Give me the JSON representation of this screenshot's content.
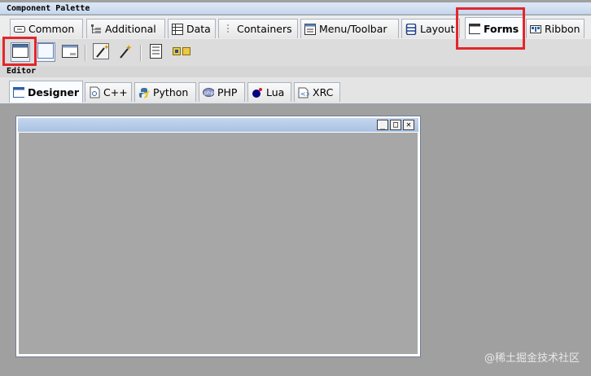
{
  "palette": {
    "header": "Component Palette",
    "tabs": [
      {
        "label": "Common",
        "icon": "button-icon"
      },
      {
        "label": "Additional",
        "icon": "tree-icon"
      },
      {
        "label": "Data",
        "icon": "grid-icon"
      },
      {
        "label": "Containers",
        "icon": "panel-icon"
      },
      {
        "label": "Menu/Toolbar",
        "icon": "menu-icon"
      },
      {
        "label": "Layout",
        "icon": "sizer-icon"
      },
      {
        "label": "Forms",
        "icon": "frame-icon",
        "active": true
      },
      {
        "label": "Ribbon",
        "icon": "ribbon-icon"
      }
    ],
    "toolbar": [
      {
        "icon": "frame-icon"
      },
      {
        "icon": "panel-icon"
      },
      {
        "icon": "dialog-icon"
      },
      {
        "icon": "wizard-icon"
      },
      {
        "icon": "wizard-page-icon"
      },
      {
        "icon": "menubar-icon"
      },
      {
        "icon": "toolbar-icon"
      }
    ]
  },
  "editor": {
    "header": "Editor",
    "tabs": [
      {
        "label": "Designer",
        "icon": "designer-icon",
        "active": true
      },
      {
        "label": "C++",
        "icon": "cpp-file-icon"
      },
      {
        "label": "Python",
        "icon": "python-icon"
      },
      {
        "label": "PHP",
        "icon": "php-icon"
      },
      {
        "label": "Lua",
        "icon": "lua-icon"
      },
      {
        "label": "XRC",
        "icon": "xrc-icon"
      }
    ],
    "frame_buttons": {
      "minimize": "_",
      "maximize": "□",
      "close": "✕"
    }
  },
  "watermark": "@稀土掘金技术社区",
  "colors": {
    "highlight": "#e3262c",
    "canvas": "#a0a0a0",
    "titlebar": "#b8cde8"
  }
}
